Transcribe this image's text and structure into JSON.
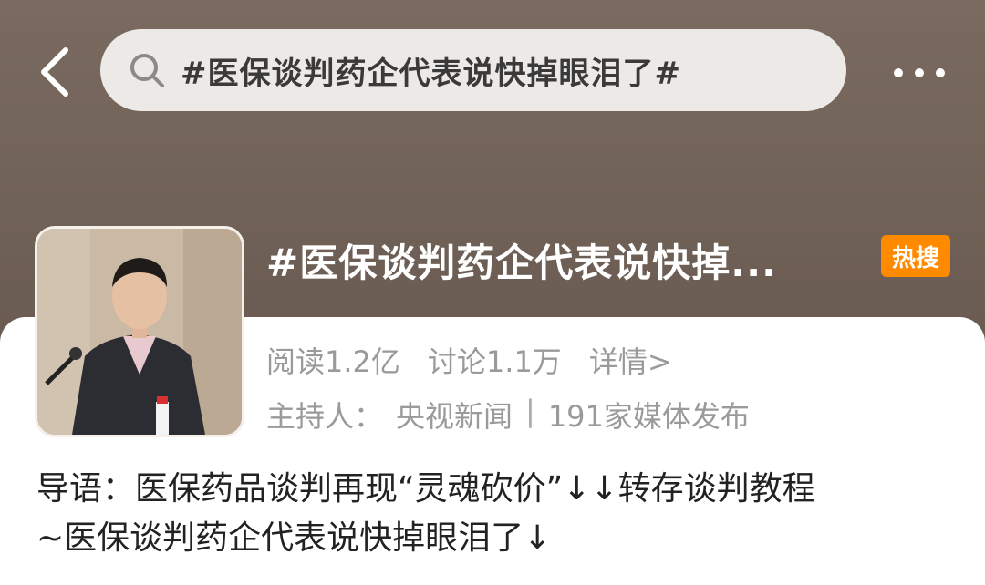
{
  "search": {
    "query": "#医保谈判药企代表说快掉眼泪了#"
  },
  "topic": {
    "title": "#医保谈判药企代表说快掉...",
    "badge": "热搜"
  },
  "stats": {
    "reads": "阅读1.2亿",
    "discussions": "讨论1.1万",
    "detail": "详情>"
  },
  "host": {
    "label": "主持人：",
    "name": "央视新闻",
    "separator": "|",
    "media": "191家媒体发布"
  },
  "intro": {
    "line1": "导语：医保药品谈判再现“灵魂砍价”↓↓转存谈判教程",
    "line2": "~医保谈判药企代表说快掉眼泪了↓"
  },
  "colors": {
    "header_bg": "#73645a",
    "badge": "#ff8a00",
    "muted_text": "#9a9a9a"
  },
  "icons": {
    "back": "chevron-left-icon",
    "search": "search-icon",
    "more": "more-dots-icon"
  }
}
